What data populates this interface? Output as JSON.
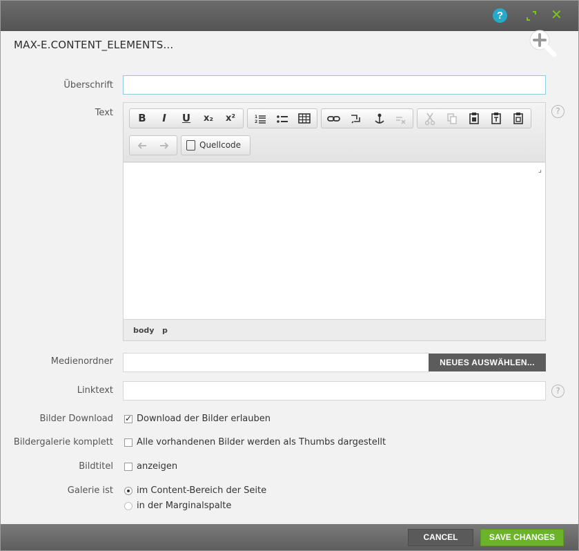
{
  "titlebar": {
    "help_glyph": "?",
    "icons": [
      "help-icon",
      "resize-icon",
      "close-icon"
    ],
    "close_glyph": "✕",
    "accent": "#7ac51e",
    "help_color": "#27a9c9"
  },
  "header": {
    "module_title": "MAX-E.CONTENT_ELEMENTS..."
  },
  "form": {
    "heading_label": "Überschrift",
    "heading_value": "",
    "text_label": "Text",
    "media_folder_label": "Medienordner",
    "media_folder_value": "",
    "select_new_button": "NEUES AUSWÄHLEN...",
    "link_text_label": "Linktext",
    "link_text_value": "",
    "help_glyph": "?",
    "image_download_label": "Bilder Download",
    "image_download_option": "Download der Bilder erlauben",
    "image_download_checked": true,
    "gallery_complete_label": "Bildergalerie komplett",
    "gallery_complete_option": "Alle vorhandenen Bilder werden als Thumbs dargestellt",
    "gallery_complete_checked": false,
    "image_title_label": "Bildtitel",
    "image_title_option": "anzeigen",
    "image_title_checked": false,
    "gallery_is_label": "Galerie ist",
    "gallery_is_options": [
      "im Content-Bereich der Seite",
      "in der Marginalspalte"
    ],
    "gallery_is_selected": 0
  },
  "editor": {
    "toolbar_row1": {
      "format": [
        "B",
        "I",
        "U",
        "x₂",
        "x²"
      ],
      "lists": [
        "numbered-list-icon",
        "bulleted-list-icon",
        "table-icon"
      ],
      "links": [
        "link-icon",
        "unlink-icon",
        "anchor-icon",
        "remove-link-icon"
      ],
      "clipboard": [
        "cut-icon",
        "copy-icon",
        "paste-icon",
        "paste-text-icon",
        "paste-word-icon"
      ]
    },
    "toolbar_row2": {
      "history": [
        "undo-icon",
        "redo-icon"
      ],
      "source_label": "Quellcode"
    },
    "content": "",
    "resize_glyph": "⌟",
    "path": [
      "body",
      "p"
    ]
  },
  "footer": {
    "cancel_label": "CANCEL",
    "save_label": "SAVE CHANGES",
    "save_color": "#6bb32a"
  }
}
